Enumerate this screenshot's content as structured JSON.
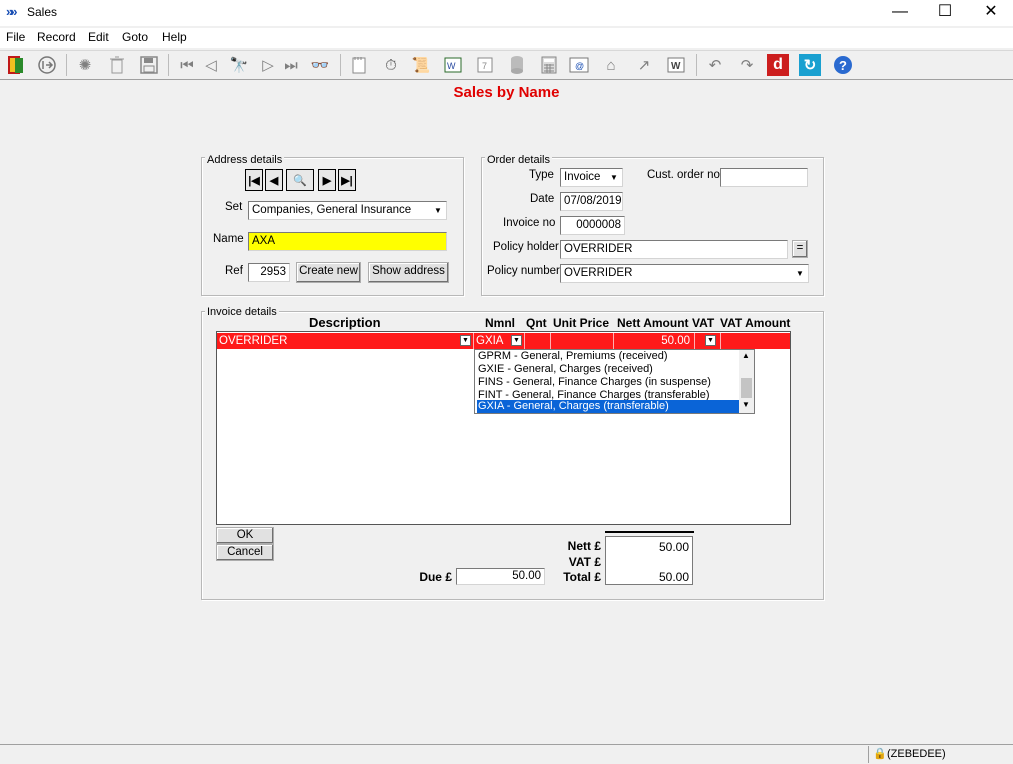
{
  "window": {
    "title": "Sales",
    "minimize": "—",
    "maximize": "☐",
    "close": "✕"
  },
  "menu": [
    "File",
    "Record",
    "Edit",
    "Goto",
    "Help"
  ],
  "form_title": "Sales by Name",
  "address": {
    "legend": "Address details",
    "set_label": "Set",
    "set_value": "Companies, General Insurance",
    "name_label": "Name",
    "name_value": "AXA",
    "ref_label": "Ref",
    "ref_value": "2953",
    "create_new": "Create new",
    "show_address": "Show address"
  },
  "order": {
    "legend": "Order details",
    "type_label": "Type",
    "type_value": "Invoice",
    "cust_order_label": "Cust. order no",
    "cust_order_value": "",
    "date_label": "Date",
    "date_value": "07/08/2019",
    "invoice_no_label": "Invoice no",
    "invoice_no_value": "0000008",
    "policy_holder_label": "Policy holder",
    "policy_holder_value": "OVERRIDER",
    "policy_holder_btn": "=",
    "policy_number_label": "Policy number",
    "policy_number_value": "OVERRIDER"
  },
  "invoice": {
    "legend": "Invoice details",
    "columns": [
      "Description",
      "Nmnl",
      "Qnt",
      "Unit Price",
      "Nett Amount",
      "VAT",
      "VAT Amount"
    ],
    "row": {
      "description": "OVERRIDER",
      "nmnl": "GXIA",
      "qnt": "",
      "unit_price": "",
      "nett_amount": "50.00",
      "vat": "",
      "vat_amount": ""
    },
    "nominal_options": [
      "GPRM - General, Premiums (received)",
      "GXIE - General, Charges (received)",
      "FINS - General, Finance Charges (in suspense)",
      "FINT - General, Finance Charges (transferable)",
      "GXIA - General, Charges (transferable)"
    ],
    "selected_option_index": 4
  },
  "buttons": {
    "ok": "OK",
    "cancel": "Cancel"
  },
  "totals": {
    "due_label": "Due £",
    "due_value": "50.00",
    "nett_label": "Nett £",
    "nett_value": "50.00",
    "vat_label": "VAT £",
    "vat_value": "",
    "total_label": "Total £",
    "total_value": "50.00"
  },
  "status": {
    "user": "(ZEBEDEE)"
  },
  "toolbar_icons": [
    "exit-icon",
    "back-icon",
    "new-icon",
    "delete-icon",
    "save-icon",
    "first-icon",
    "prev-icon",
    "find-icon",
    "next-icon",
    "last-icon",
    "glasses-icon",
    "notepad-icon",
    "timer-icon",
    "scroll-icon",
    "word-icon",
    "calendar-icon",
    "database-icon",
    "calculator-icon",
    "email-icon",
    "home-icon",
    "trend-icon",
    "wordpad-icon",
    "undo-icon",
    "redo-icon",
    "d-icon",
    "refresh-icon",
    "help-icon"
  ],
  "colors": {
    "form_title": "#e00000",
    "selected_row": "#ff1a1a",
    "name_highlight": "#ffff00",
    "selection_blue": "#0a64d7"
  }
}
